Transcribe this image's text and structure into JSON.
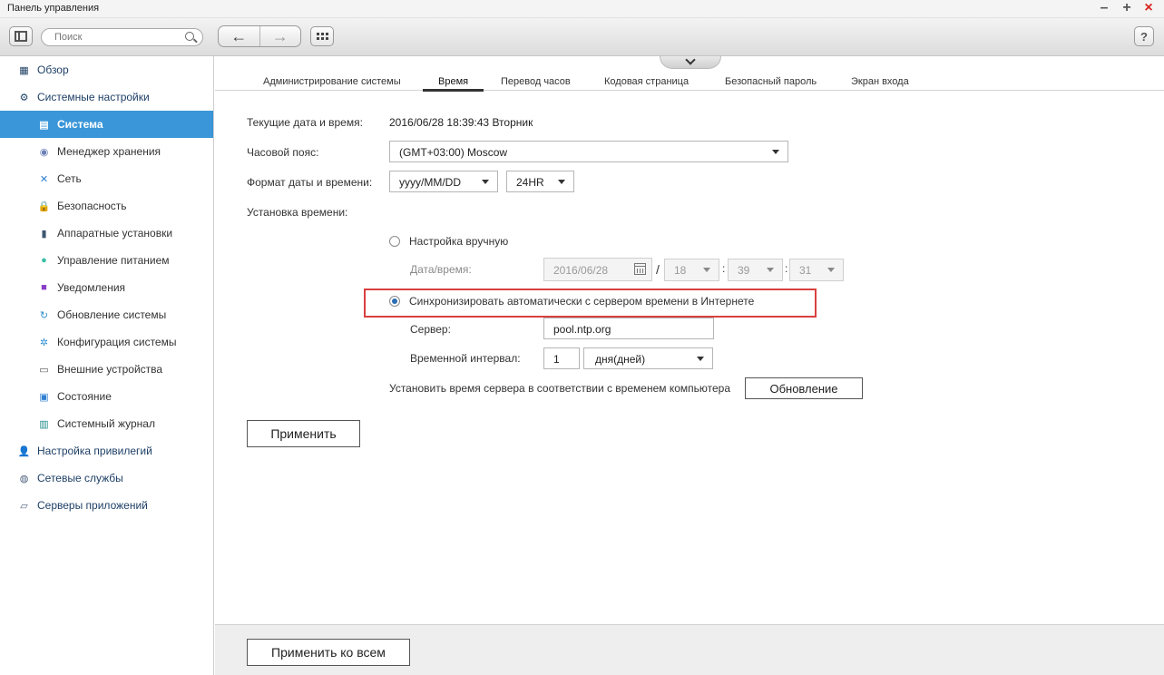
{
  "window": {
    "title": "Панель управления",
    "controls": {
      "minimize": "–",
      "maximize": "+",
      "close": "×"
    }
  },
  "toolbar": {
    "search_placeholder": "Поиск",
    "back": "←",
    "forward": "→",
    "help": "?"
  },
  "sidebar": {
    "items": [
      {
        "label": "Обзор",
        "level": "top",
        "icon": "overview-icon",
        "glyph": "▦"
      },
      {
        "label": "Системные настройки",
        "level": "top",
        "icon": "settings-gear-icon",
        "glyph": "⚙"
      },
      {
        "label": "Система",
        "level": "sub",
        "icon": "system-icon",
        "glyph": "▤",
        "active": true
      },
      {
        "label": "Менеджер хранения",
        "level": "sub",
        "icon": "storage-icon",
        "glyph": "◉"
      },
      {
        "label": "Сеть",
        "level": "sub",
        "icon": "network-icon",
        "glyph": "✕"
      },
      {
        "label": "Безопасность",
        "level": "sub",
        "icon": "lock-icon",
        "glyph": "🔒"
      },
      {
        "label": "Аппаратные установки",
        "level": "sub",
        "icon": "hardware-icon",
        "glyph": "▮"
      },
      {
        "label": "Управление питанием",
        "level": "sub",
        "icon": "power-bulb-icon",
        "glyph": "●"
      },
      {
        "label": "Уведомления",
        "level": "sub",
        "icon": "notification-icon",
        "glyph": "■"
      },
      {
        "label": "Обновление системы",
        "level": "sub",
        "icon": "update-icon",
        "glyph": "↻"
      },
      {
        "label": "Конфигурация системы",
        "level": "sub",
        "icon": "config-icon",
        "glyph": "✲"
      },
      {
        "label": "Внешние устройства",
        "level": "sub",
        "icon": "external-device-icon",
        "glyph": "▭"
      },
      {
        "label": "Состояние",
        "level": "sub",
        "icon": "monitor-icon",
        "glyph": "▣"
      },
      {
        "label": "Системный журнал",
        "level": "sub",
        "icon": "log-icon",
        "glyph": "▥"
      },
      {
        "label": "Настройка привилегий",
        "level": "top",
        "icon": "user-icon",
        "glyph": "👤"
      },
      {
        "label": "Сетевые службы",
        "level": "top",
        "icon": "globe-icon",
        "glyph": "◍"
      },
      {
        "label": "Серверы приложений",
        "level": "top",
        "icon": "app-server-icon",
        "glyph": "▱"
      }
    ]
  },
  "tabs": [
    {
      "label": "Администрирование системы"
    },
    {
      "label": "Время",
      "active": true
    },
    {
      "label": "Перевод часов"
    },
    {
      "label": "Кодовая страница"
    },
    {
      "label": "Безопасный пароль"
    },
    {
      "label": "Экран входа"
    }
  ],
  "form": {
    "current_datetime_label": "Текущие дата и время:",
    "current_datetime_value": "2016/06/28 18:39:43 Вторник",
    "timezone_label": "Часовой пояс:",
    "timezone_value": "(GMT+03:00) Moscow",
    "format_label": "Формат даты и времени:",
    "date_format_value": "yyyy/MM/DD",
    "time_format_value": "24HR",
    "time_setting_label": "Установка времени:",
    "manual_label": "Настройка вручную",
    "manual_checked": false,
    "datetime_label": "Дата/время:",
    "manual_date": "2016/06/28",
    "slash": "/",
    "colon": ":",
    "manual_hour": "18",
    "manual_minute": "39",
    "manual_second": "31",
    "auto_label": "Синхронизировать автоматически с сервером времени в Интернете",
    "auto_checked": true,
    "server_label": "Сервер:",
    "server_value": "pool.ntp.org",
    "interval_label": "Временной интервал:",
    "interval_value": "1",
    "interval_unit": "дня(дней)",
    "sync_pc_label": "Установить время сервера в соответствии с временем компьютера",
    "update_button": "Обновление",
    "apply_button": "Применить"
  },
  "footer": {
    "apply_all_button": "Применить ко всем"
  },
  "colors": {
    "sidebar_active": "#3a96d8",
    "highlight_border": "#d94040",
    "close_red": "#d9241c"
  }
}
